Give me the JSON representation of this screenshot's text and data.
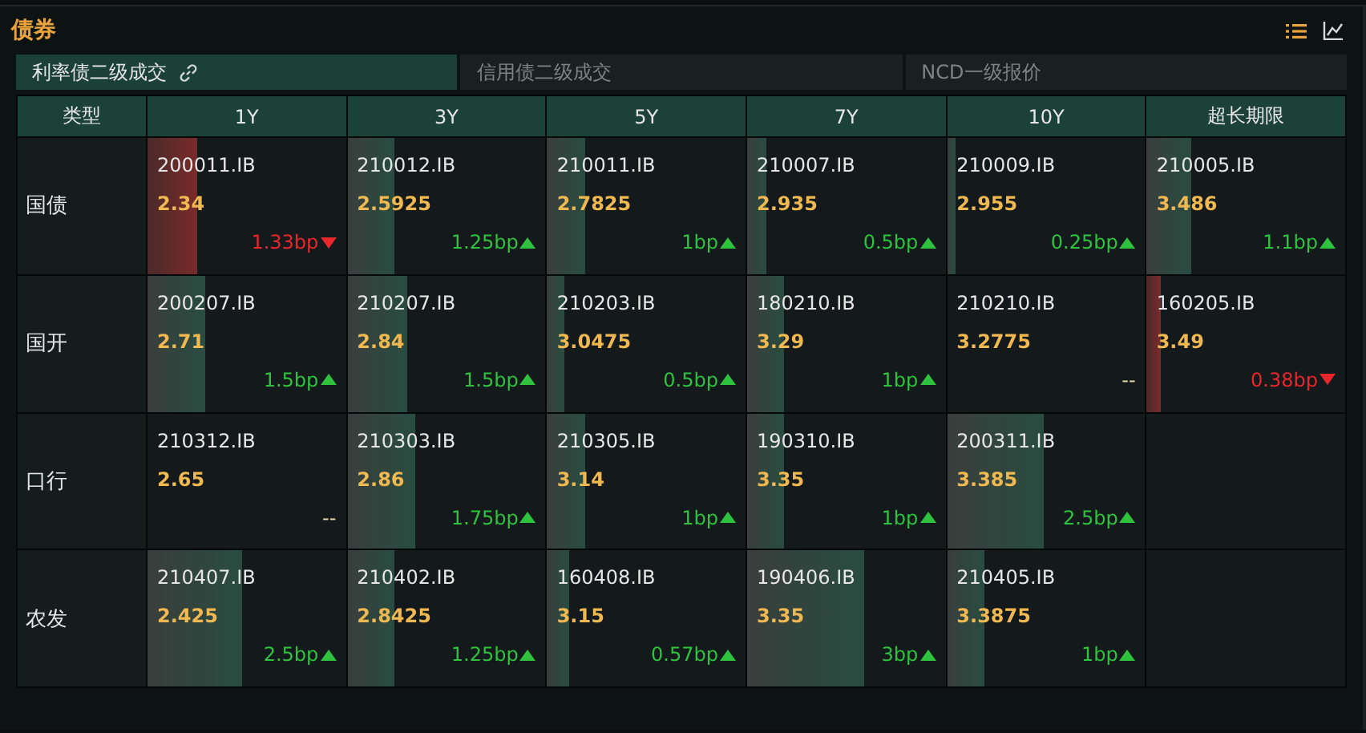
{
  "panel": {
    "title": "债券"
  },
  "tabs": [
    {
      "label": "利率债二级成交",
      "selected": true,
      "linked": true
    },
    {
      "label": "信用债二级成交",
      "selected": false,
      "linked": false
    },
    {
      "label": "NCD一级报价",
      "selected": false,
      "linked": false
    }
  ],
  "table": {
    "corner": "类型",
    "columns": [
      "1Y",
      "3Y",
      "5Y",
      "7Y",
      "10Y",
      "超长期限"
    ],
    "rows": [
      {
        "type": "国债",
        "cells": [
          {
            "kind": "down",
            "code": "200011.IB",
            "yield": "2.34",
            "change": "1.33bp",
            "level": 0.25
          },
          {
            "kind": "up",
            "code": "210012.IB",
            "yield": "2.5925",
            "change": "1.25bp",
            "level": 0.24
          },
          {
            "kind": "up",
            "code": "210011.IB",
            "yield": "2.7825",
            "change": "1bp",
            "level": 0.19
          },
          {
            "kind": "up",
            "code": "210007.IB",
            "yield": "2.935",
            "change": "0.5bp",
            "level": 0.1
          },
          {
            "kind": "up",
            "code": "210009.IB",
            "yield": "2.955",
            "change": "0.25bp",
            "level": 0.04
          },
          {
            "kind": "up",
            "code": "210005.IB",
            "yield": "3.486",
            "change": "1.1bp",
            "level": 0.22
          }
        ]
      },
      {
        "type": "国开",
        "cells": [
          {
            "kind": "up",
            "code": "200207.IB",
            "yield": "2.71",
            "change": "1.5bp",
            "level": 0.29
          },
          {
            "kind": "up",
            "code": "210207.IB",
            "yield": "2.84",
            "change": "1.5bp",
            "level": 0.3
          },
          {
            "kind": "up",
            "code": "210203.IB",
            "yield": "3.0475",
            "change": "0.5bp",
            "level": 0.09
          },
          {
            "kind": "up",
            "code": "180210.IB",
            "yield": "3.29",
            "change": "1bp",
            "level": 0.19
          },
          {
            "kind": "flat",
            "code": "210210.IB",
            "yield": "3.2775",
            "change": "--"
          },
          {
            "kind": "down",
            "code": "160205.IB",
            "yield": "3.49",
            "change": "0.38bp",
            "level": 0.07
          }
        ]
      },
      {
        "type": "口行",
        "cells": [
          {
            "kind": "flat",
            "code": "210312.IB",
            "yield": "2.65",
            "change": "--"
          },
          {
            "kind": "up",
            "code": "210303.IB",
            "yield": "2.86",
            "change": "1.75bp",
            "level": 0.34
          },
          {
            "kind": "up",
            "code": "210305.IB",
            "yield": "3.14",
            "change": "1bp",
            "level": 0.19
          },
          {
            "kind": "up",
            "code": "190310.IB",
            "yield": "3.35",
            "change": "1bp",
            "level": 0.19
          },
          {
            "kind": "up",
            "code": "200311.IB",
            "yield": "3.385",
            "change": "2.5bp",
            "level": 0.49
          },
          {
            "kind": "empty"
          }
        ]
      },
      {
        "type": "农发",
        "cells": [
          {
            "kind": "up",
            "code": "210407.IB",
            "yield": "2.425",
            "change": "2.5bp",
            "level": 0.48
          },
          {
            "kind": "up",
            "code": "210402.IB",
            "yield": "2.8425",
            "change": "1.25bp",
            "level": 0.24
          },
          {
            "kind": "up",
            "code": "160408.IB",
            "yield": "3.15",
            "change": "0.57bp",
            "level": 0.11
          },
          {
            "kind": "up",
            "code": "190406.IB",
            "yield": "3.35",
            "change": "3bp",
            "level": 0.59
          },
          {
            "kind": "up",
            "code": "210405.IB",
            "yield": "3.3875",
            "change": "1bp",
            "level": 0.19
          },
          {
            "kind": "empty"
          }
        ]
      }
    ]
  }
}
